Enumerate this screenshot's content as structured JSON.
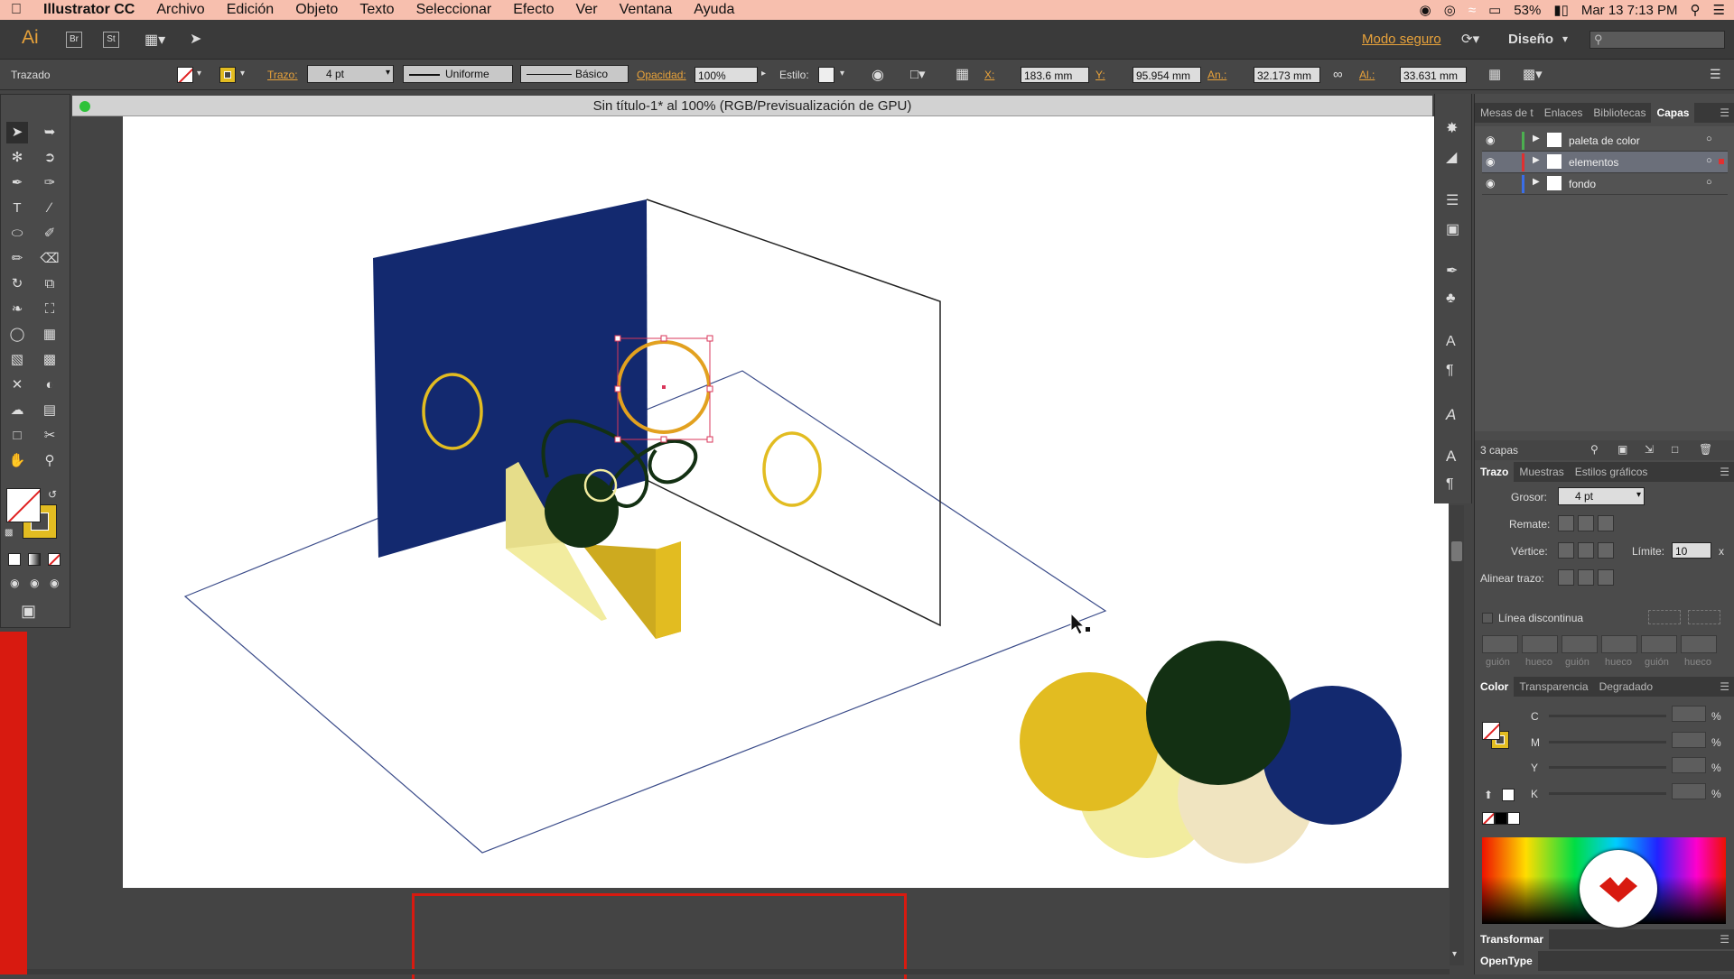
{
  "menubar": {
    "app_name": "Illustrator CC",
    "items": [
      "Archivo",
      "Edición",
      "Objeto",
      "Texto",
      "Seleccionar",
      "Efecto",
      "Ver",
      "Ventana",
      "Ayuda"
    ],
    "battery": "53%",
    "datetime": "Mar 13  7:13 PM"
  },
  "appbar": {
    "logo": "Ai",
    "bridge": "Br",
    "stock": "St",
    "safe_mode": "Modo seguro",
    "workspace": "Diseño"
  },
  "control": {
    "object_type": "Trazado",
    "stroke_label": "Trazo:",
    "stroke_weight": "4 pt",
    "profile_label": "Uniforme",
    "brush_label": "Básico",
    "opacity_label": "Opacidad:",
    "opacity_value": "100%",
    "style_label": "Estilo:",
    "x_label": "X:",
    "x_value": "183.6 mm",
    "y_label": "Y:",
    "y_value": "95.954 mm",
    "w_label": "An.:",
    "w_value": "32.173 mm",
    "h_label": "Al.:",
    "h_value": "33.631 mm"
  },
  "document": {
    "title": "Sin título-1* al 100% (RGB/Previsualización de GPU)"
  },
  "layers_panel": {
    "tabs": [
      "Mesas de t",
      "Enlaces",
      "Bibliotecas",
      "Capas"
    ],
    "active_tab": "Capas",
    "layers": [
      {
        "name": "paleta de color",
        "color": "#4caf50",
        "selected": false
      },
      {
        "name": "elementos",
        "color": "#e03030",
        "selected": true
      },
      {
        "name": "fondo",
        "color": "#3a6ee8",
        "selected": false
      }
    ],
    "count": "3 capas"
  },
  "stroke_panel": {
    "tabs": [
      "Trazo",
      "Muestras",
      "Estilos gráficos"
    ],
    "weight_label": "Grosor:",
    "weight_value": "4 pt",
    "cap_label": "Remate:",
    "corner_label": "Vértice:",
    "limit_label": "Límite:",
    "limit_value": "10",
    "limit_unit": "x",
    "align_label": "Alinear trazo:",
    "dashed_label": "Línea discontinua",
    "dash_labels": [
      "guión",
      "hueco",
      "guión",
      "hueco",
      "guión",
      "hueco"
    ]
  },
  "color_panel": {
    "tabs": [
      "Color",
      "Transparencia",
      "Degradado"
    ],
    "channels": [
      "C",
      "M",
      "Y",
      "K"
    ],
    "percent": "%"
  },
  "transform_panel": {
    "title": "Transformar"
  },
  "opentype_panel": {
    "title": "OpenType"
  },
  "colors": {
    "navy": "#13296f",
    "dark_green": "#133013",
    "mustard": "#e2bc21",
    "pale_yellow": "#f2ec9f",
    "cream": "#f0e4c0",
    "deep_yellow": "#cdaa1f",
    "orange_accent": "#e8a23a"
  }
}
